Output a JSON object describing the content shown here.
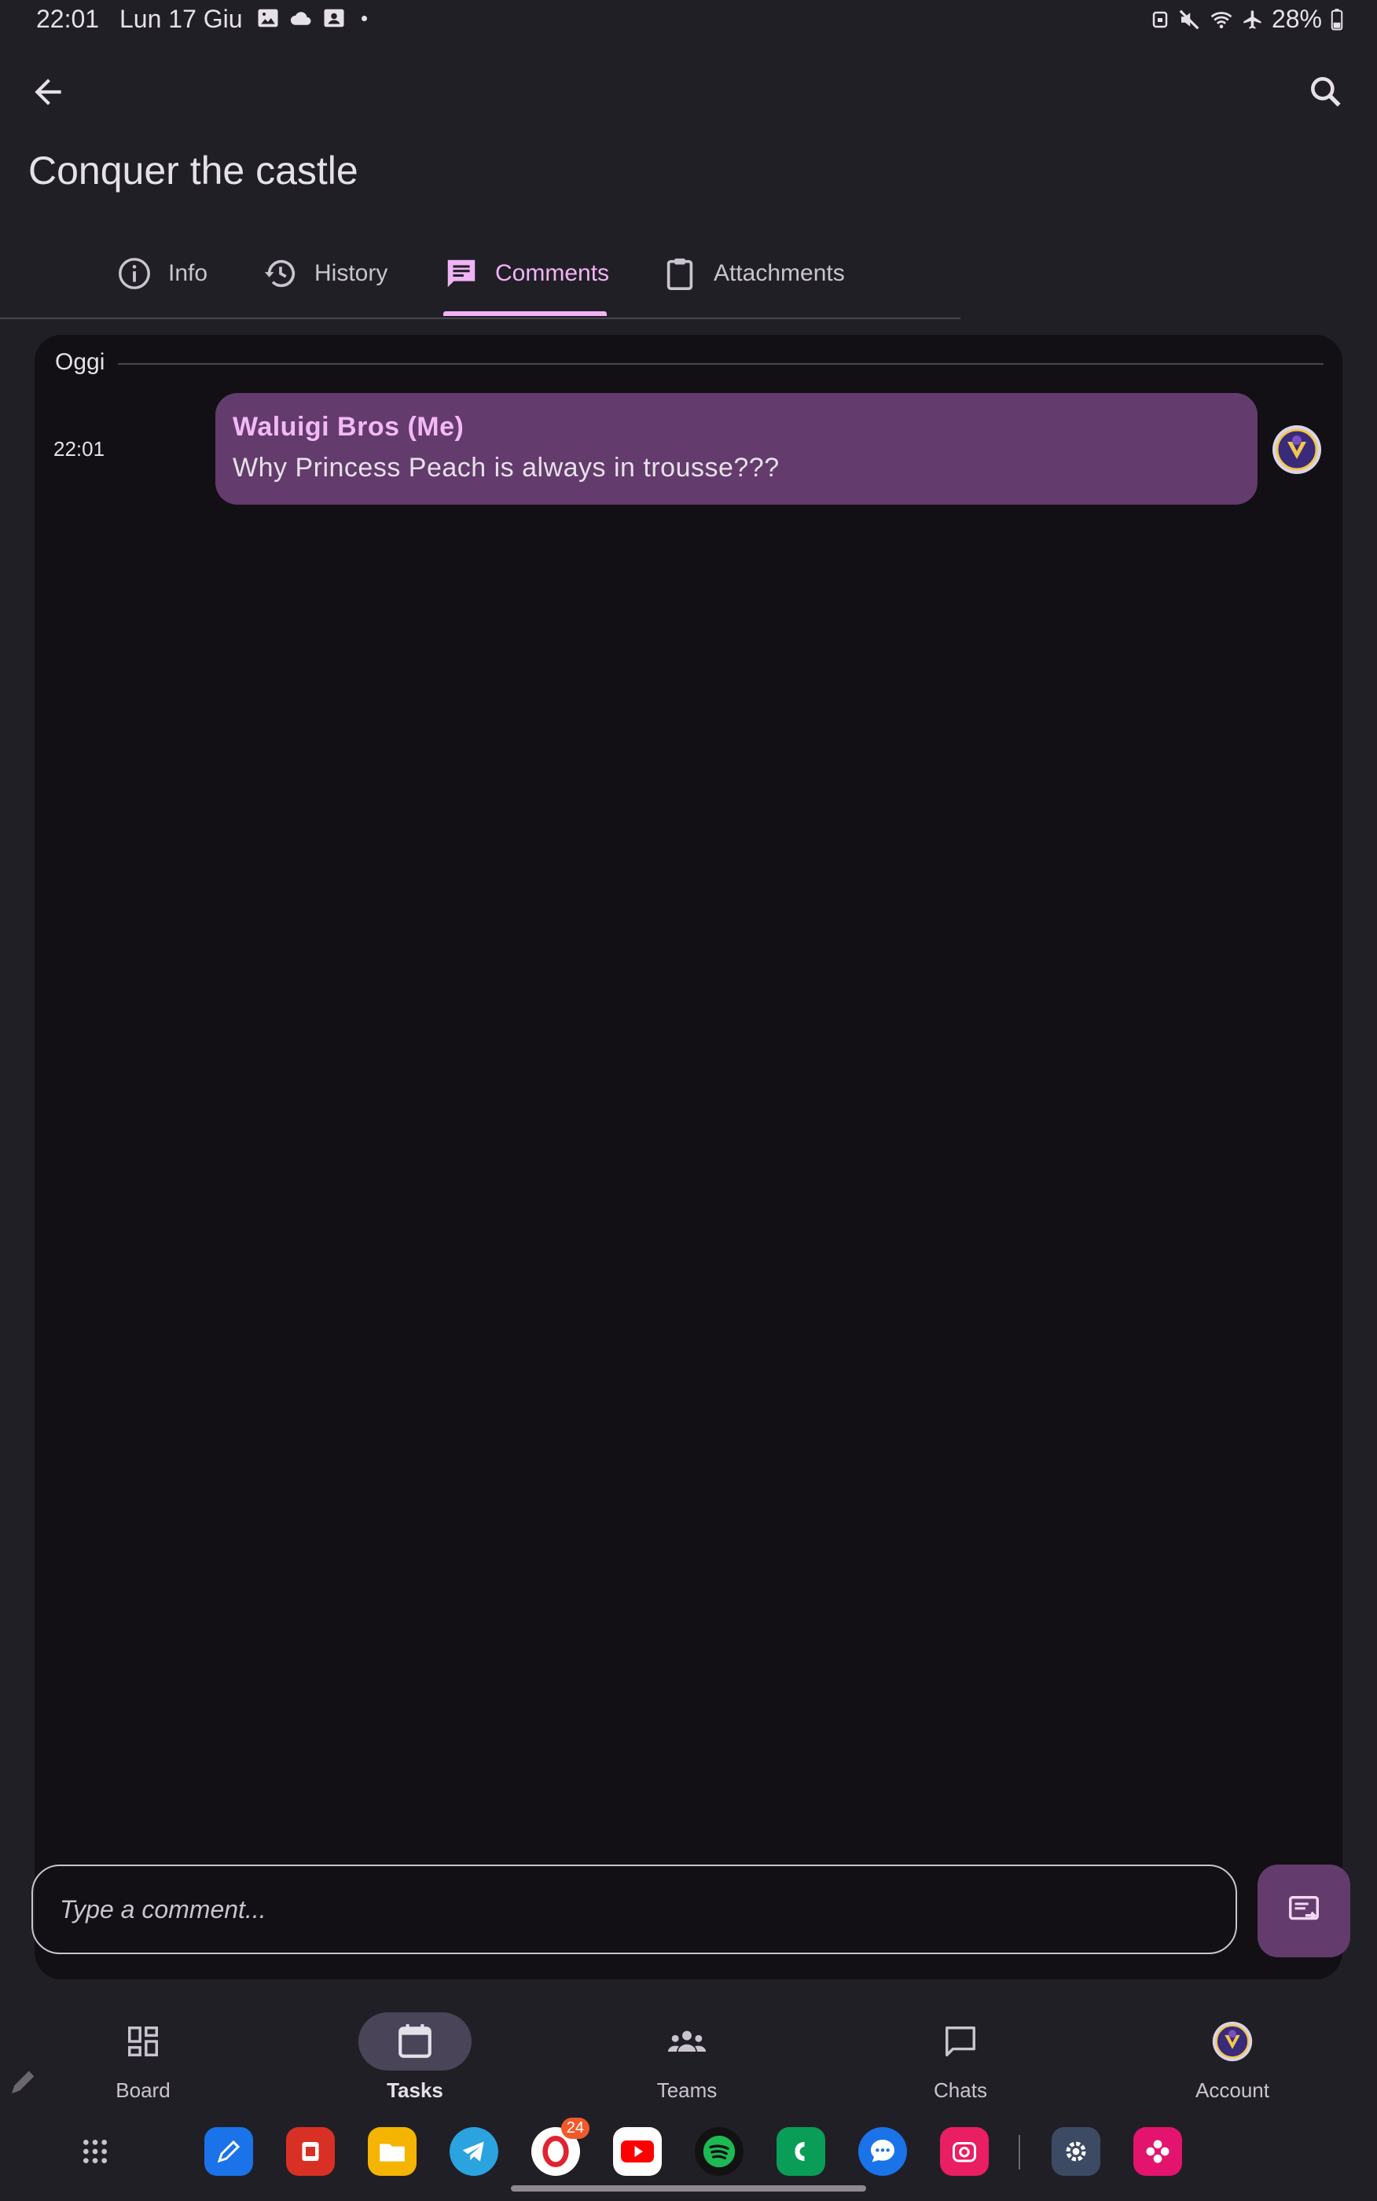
{
  "status_bar": {
    "time": "22:01",
    "date": "Lun 17 Giu",
    "battery": "28%"
  },
  "header": {
    "title": "Conquer the castle",
    "back_icon": "arrow-back-icon",
    "search_icon": "search-icon"
  },
  "tabs": [
    {
      "label": "Info",
      "icon": "info-icon",
      "active": false
    },
    {
      "label": "History",
      "icon": "history-icon",
      "active": false
    },
    {
      "label": "Comments",
      "icon": "comment-icon",
      "active": true
    },
    {
      "label": "Attachments",
      "icon": "clipboard-icon",
      "active": false
    }
  ],
  "comments": {
    "day_label": "Oggi",
    "messages": [
      {
        "time": "22:01",
        "author": "Waluigi Bros (Me)",
        "text": "Why Princess Peach is always in trousse???"
      }
    ]
  },
  "composer": {
    "placeholder": "Type a comment...",
    "value": ""
  },
  "bottom_nav": [
    {
      "label": "Board",
      "icon": "dashboard-icon",
      "active": false
    },
    {
      "label": "Tasks",
      "icon": "calendar-icon",
      "active": true
    },
    {
      "label": "Teams",
      "icon": "groups-icon",
      "active": false
    },
    {
      "label": "Chats",
      "icon": "chat-bubble-icon",
      "active": false
    },
    {
      "label": "Account",
      "icon": "avatar-icon",
      "active": false
    }
  ],
  "dock": {
    "opera_badge": "24"
  },
  "colors": {
    "background": "#211f26",
    "panel": "#121014",
    "bubble": "#633b6c",
    "accent": "#f0b4f5"
  }
}
